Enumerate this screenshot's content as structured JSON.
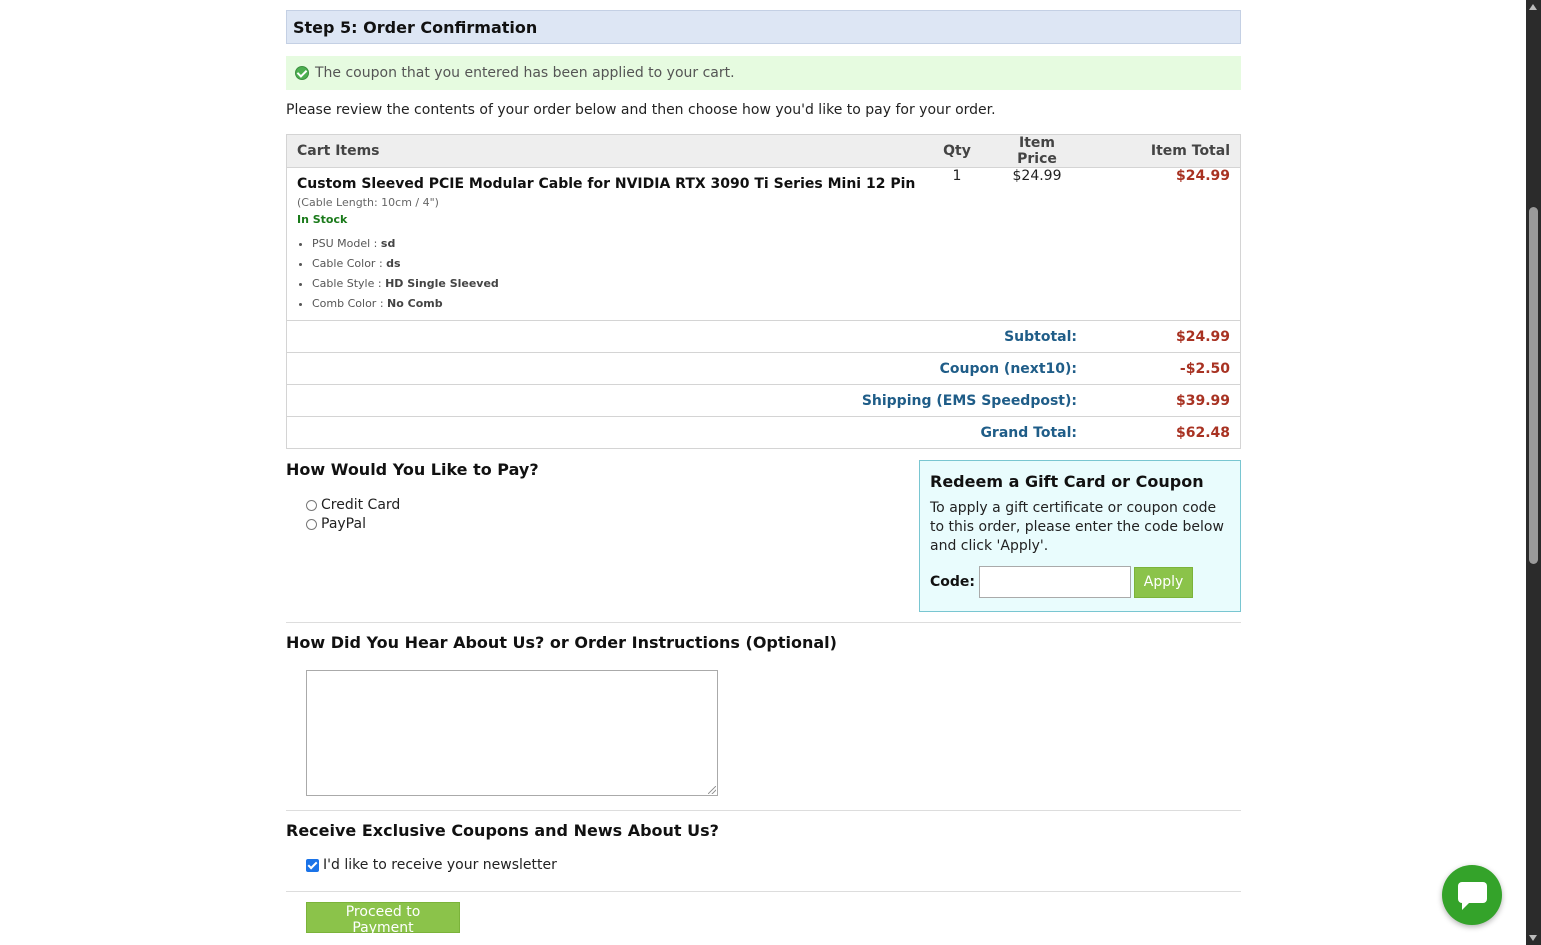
{
  "step_header": "Step 5: Order Confirmation",
  "notice": "The coupon that you entered has been applied to your cart.",
  "intro": "Please review the contents of your order below and then choose how you'd like to pay for your order.",
  "cart": {
    "headers": [
      "Cart Items",
      "Qty",
      "Item Price",
      "Item Total"
    ],
    "item": {
      "name": "Custom Sleeved PCIE Modular Cable for NVIDIA RTX 3090 Ti Series Mini 12 Pin",
      "meta": "(Cable Length: 10cm / 4\")",
      "stock": "In Stock",
      "attrs": [
        {
          "label": "PSU Model : ",
          "value": "sd"
        },
        {
          "label": "Cable Color : ",
          "value": "ds"
        },
        {
          "label": "Cable Style : ",
          "value": "HD Single Sleeved"
        },
        {
          "label": "Comb Color : ",
          "value": "No Comb"
        }
      ],
      "qty": "1",
      "price": "$24.99",
      "total": "$24.99"
    },
    "summary": [
      {
        "label": "Subtotal:",
        "value": "$24.99"
      },
      {
        "label": "Coupon (next10):",
        "value": "-$2.50"
      },
      {
        "label": "Shipping (EMS Speedpost):",
        "value": "$39.99"
      },
      {
        "label": "Grand Total:",
        "value": "$62.48"
      }
    ]
  },
  "payment": {
    "title": "How Would You Like to Pay?",
    "options": [
      "Credit Card",
      "PayPal"
    ]
  },
  "coupon": {
    "title": "Redeem a Gift Card or Coupon",
    "text": "To apply a gift certificate or coupon code to this order, please enter the code below and click 'Apply'.",
    "code_label": "Code:",
    "code_value": "",
    "apply_label": "Apply"
  },
  "instructions": {
    "title": "How Did You Hear About Us? or Order Instructions (Optional)"
  },
  "newsletter": {
    "title": "Receive Exclusive Coupons and News About Us?",
    "checkbox_label": "I'd like to receive your newsletter",
    "checked": true
  },
  "proceed_label": "Proceed to Payment",
  "colors": {
    "accent_green": "#8bc34a",
    "price_red": "#a83222",
    "label_blue": "#1f5d88",
    "chat_green": "#34a32a"
  }
}
